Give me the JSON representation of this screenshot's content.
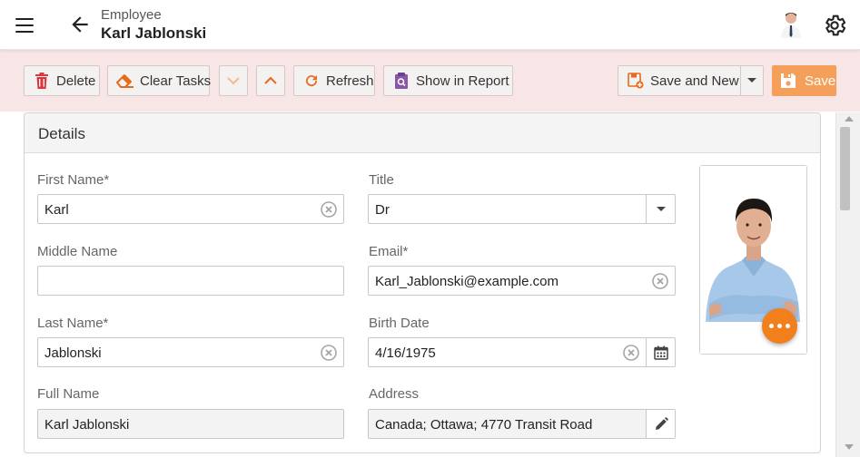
{
  "header": {
    "subtitle": "Employee",
    "title": "Karl Jablonski"
  },
  "toolbar": {
    "delete_label": "Delete",
    "clear_tasks_label": "Clear Tasks",
    "refresh_label": "Refresh",
    "show_in_report_label": "Show in Report",
    "save_and_new_label": "Save and New",
    "save_label": "Save"
  },
  "details": {
    "title": "Details",
    "first_name_label": "First Name*",
    "first_name_value": "Karl",
    "middle_name_label": "Middle Name",
    "middle_name_value": "",
    "last_name_label": "Last Name*",
    "last_name_value": "Jablonski",
    "full_name_label": "Full Name",
    "full_name_value": "Karl Jablonski",
    "title_label": "Title",
    "title_value": "Dr",
    "email_label": "Email*",
    "email_value": "Karl_Jablonski@example.com",
    "birth_date_label": "Birth Date",
    "birth_date_value": "4/16/1975",
    "address_label": "Address",
    "address_value": "Canada; Ottawa; 4770 Transit Road"
  },
  "colors": {
    "accent": "#f07f1c",
    "toolbar_bg": "#f8e6e7",
    "save_button": "#f5a05a",
    "icon_orange": "#e8681c",
    "delete_red": "#d9363e",
    "report_purple": "#8a57a8"
  },
  "icons": {
    "menu": "hamburger-icon",
    "back": "arrow-left-icon",
    "settings": "gear-icon",
    "delete": "trash-icon",
    "clear": "eraser-icon",
    "next": "chevron-down-icon",
    "previous": "chevron-up-icon",
    "refresh": "refresh-icon",
    "report": "report-icon",
    "save_new": "save-new-icon",
    "save": "floppy-icon",
    "clear_field": "clear-circle-icon",
    "calendar": "calendar-icon",
    "edit": "pencil-icon",
    "more": "more-dots-icon"
  }
}
